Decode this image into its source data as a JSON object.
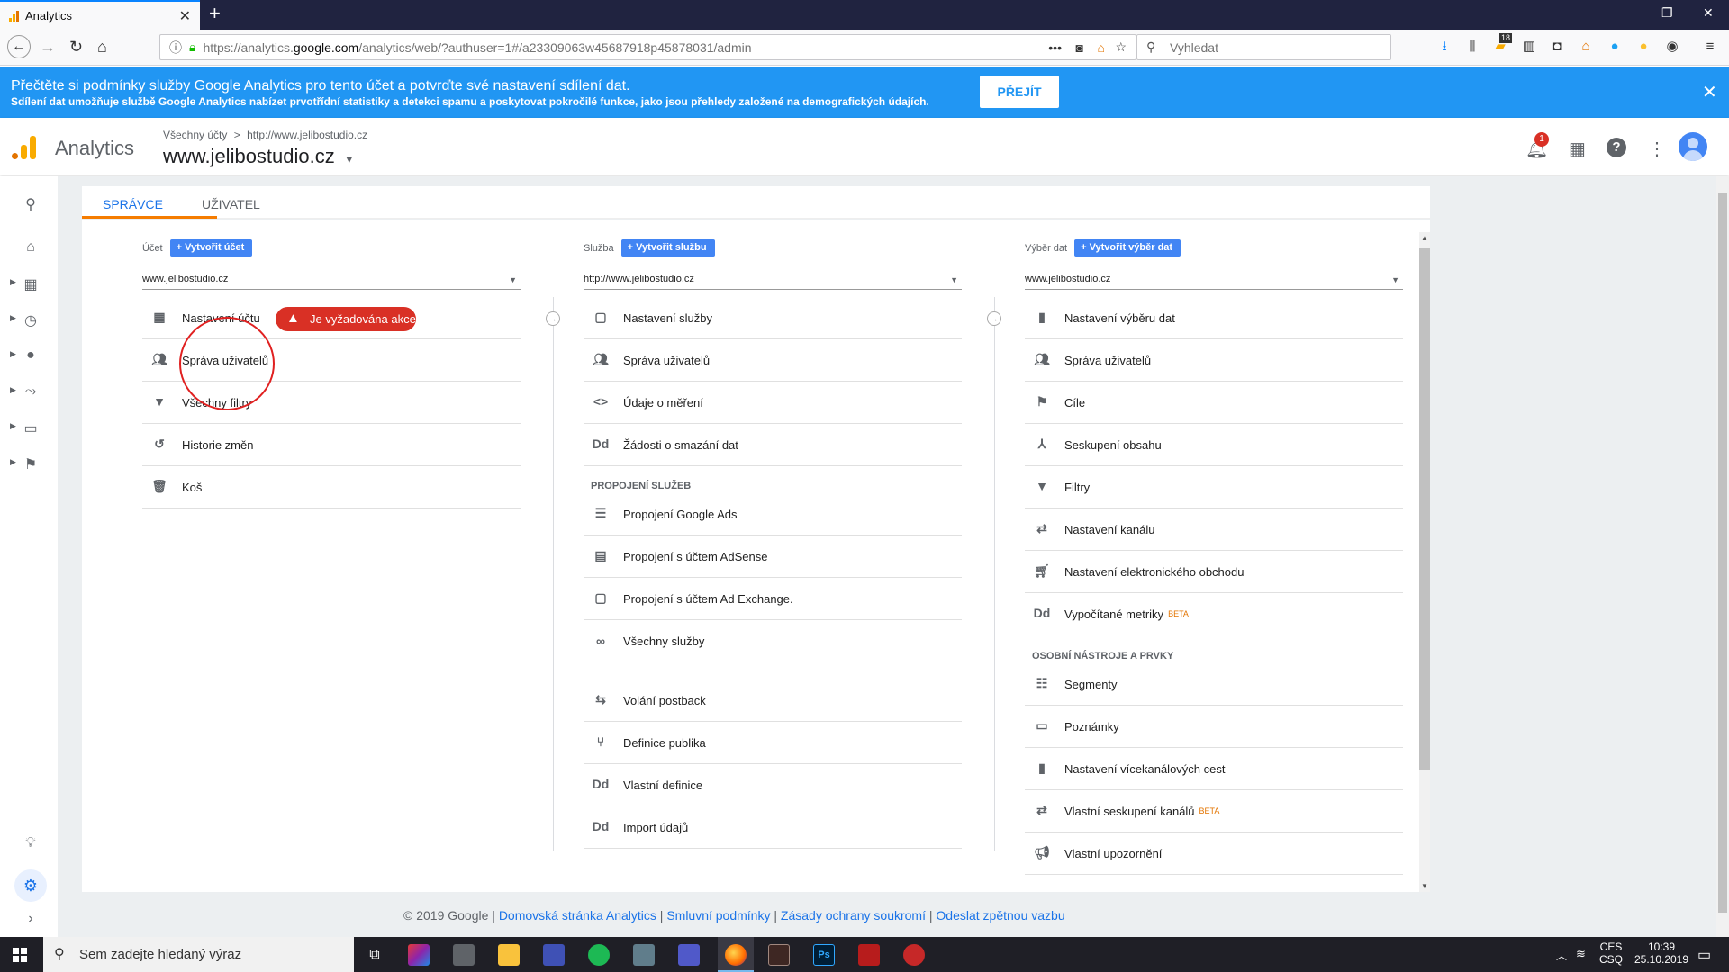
{
  "browser": {
    "tab_title": "Analytics",
    "tab_close": "✕",
    "new_tab": "+",
    "url_prefix": "https://analytics.",
    "url_domain": "google.com",
    "url_rest": "/analytics/web/?authuser=1#/a23309063w45687918p45878031/admin",
    "search_placeholder": "Vyhledat",
    "badge_count": "18"
  },
  "banner": {
    "line1": "Přečtěte si podmínky služby Google Analytics pro tento účet a potvrďte své nastavení sdílení dat.",
    "line2": "Sdílení dat umožňuje službě Google Analytics nabízet prvotřídní statistiky a detekci spamu a poskytovat pokročilé funkce, jako jsou přehledy založené na demografických údajích.",
    "button": "PŘEJÍT",
    "close": "✕"
  },
  "header": {
    "product": "Analytics",
    "crumb_all": "Všechny účty",
    "crumb_sep": ">",
    "crumb_property": "http://www.jelibostudio.cz",
    "account_name": "www.jelibostudio.cz",
    "notif_count": "1"
  },
  "tabs": {
    "admin": "SPRÁVCE",
    "user": "UŽIVATEL"
  },
  "account_col": {
    "label": "Účet",
    "create_btn": "Vytvořit účet",
    "selected": "www.jelibostudio.cz",
    "items": [
      {
        "label": "Nastavení účtu",
        "icon": "building-icon"
      },
      {
        "label": "Správa uživatelů",
        "icon": "people-icon"
      },
      {
        "label": "Všechny filtry",
        "icon": "filter-icon"
      },
      {
        "label": "Historie změn",
        "icon": "history-icon"
      },
      {
        "label": "Koš",
        "icon": "trash-icon"
      }
    ],
    "alert": "Je vyžadována akce"
  },
  "property_col": {
    "label": "Služba",
    "create_btn": "Vytvořit službu",
    "selected": "http://www.jelibostudio.cz",
    "items": [
      {
        "label": "Nastavení služby"
      },
      {
        "label": "Správa uživatelů"
      },
      {
        "label": "Údaje o měření"
      },
      {
        "label": "Žádosti o smazání dat"
      }
    ],
    "section": "PROPOJENÍ SLUŽEB",
    "links": [
      {
        "label": "Propojení Google Ads"
      },
      {
        "label": "Propojení s účtem AdSense"
      },
      {
        "label": "Propojení s účtem Ad Exchange."
      },
      {
        "label": "Všechny služby"
      }
    ],
    "extra": [
      {
        "label": "Volání postback"
      },
      {
        "label": "Definice publika"
      },
      {
        "label": "Vlastní definice"
      },
      {
        "label": "Import údajů"
      }
    ]
  },
  "view_col": {
    "label": "Výběr dat",
    "create_btn": "Vytvořit výběr dat",
    "selected": "www.jelibostudio.cz",
    "items": [
      {
        "label": "Nastavení výběru dat"
      },
      {
        "label": "Správa uživatelů"
      },
      {
        "label": "Cíle"
      },
      {
        "label": "Seskupení obsahu"
      },
      {
        "label": "Filtry"
      },
      {
        "label": "Nastavení kanálu"
      },
      {
        "label": "Nastavení elektronického obchodu"
      },
      {
        "label": "Vypočítané metriky",
        "beta": "BETA"
      }
    ],
    "section": "OSOBNÍ NÁSTROJE A PRVKY",
    "tools": [
      {
        "label": "Segmenty"
      },
      {
        "label": "Poznámky"
      },
      {
        "label": "Nastavení vícekanálových cest"
      },
      {
        "label": "Vlastní seskupení kanálů",
        "beta": "BETA"
      },
      {
        "label": "Vlastní upozornění"
      }
    ]
  },
  "footer": {
    "copyright": "© 2019 Google",
    "sep": "|",
    "links": [
      "Domovská stránka Analytics",
      "Smluvní podmínky",
      "Zásady ochrany soukromí",
      "Odeslat zpětnou vazbu"
    ]
  },
  "taskbar": {
    "search": "Sem zadejte hledaný výraz",
    "lang1": "CES",
    "lang2": "CSQ",
    "time": "10:39",
    "date": "25.10.2019"
  },
  "colors": {
    "accent": "#1a73e8",
    "banner": "#2196f3",
    "alert": "#d93025",
    "tab_underline": "#f57c00",
    "highlight_circle": "#e02020"
  }
}
